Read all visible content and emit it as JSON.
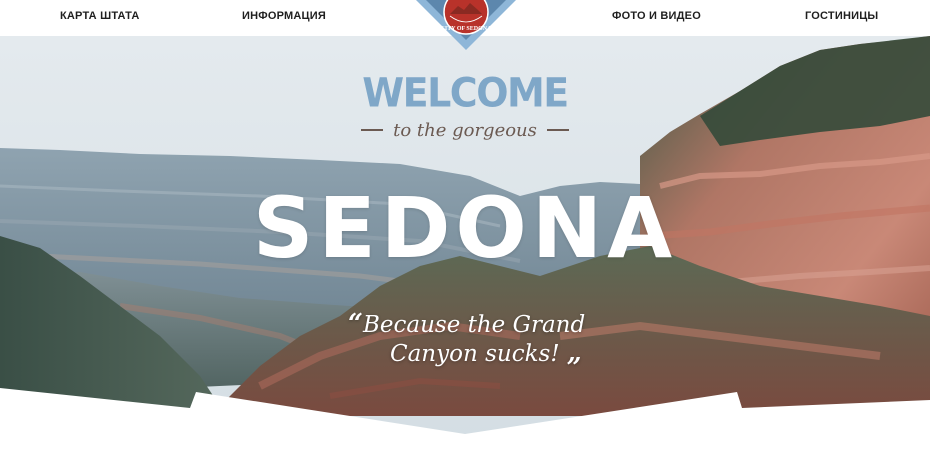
{
  "nav": {
    "items": [
      {
        "label": "КАРТА ШТАТА"
      },
      {
        "label": "ИНФОРМАЦИЯ"
      },
      {
        "label": "ФОТО И ВИДЕО"
      },
      {
        "label": "ГОСТИНИЦЫ"
      }
    ]
  },
  "logo": {
    "text": "CITY OF SEDONA"
  },
  "hero": {
    "welcome": "WELCOME",
    "tagline": "to the gorgeous",
    "title": "SEDONA",
    "quote_open": "“",
    "quote_line1": "Because the Grand",
    "quote_line2": "Canyon sucks!",
    "quote_close": "„"
  },
  "colors": {
    "nav_text": "#1f1f1f",
    "welcome": "#7fa7c8",
    "tagline": "#6b5a52",
    "logo_frame": "#8eb6d8",
    "logo_inner": "#b8322a",
    "sky": "#dfe6eb",
    "rock": "#b9705e",
    "forest": "#3f5a44"
  }
}
